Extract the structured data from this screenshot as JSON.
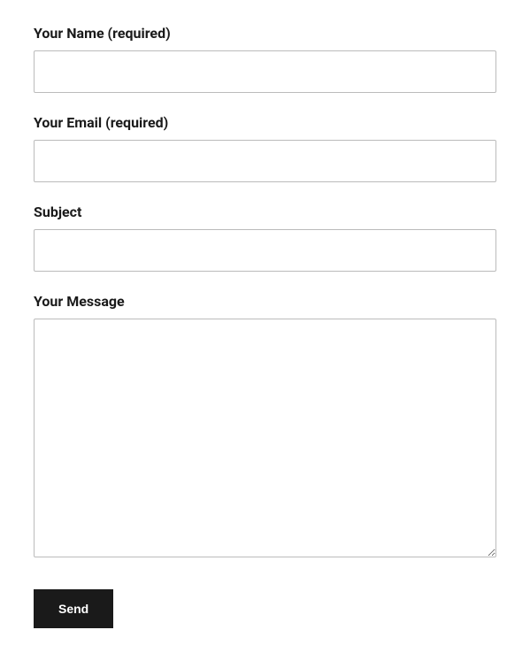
{
  "form": {
    "name": {
      "label": "Your Name (required)",
      "value": ""
    },
    "email": {
      "label": "Your Email (required)",
      "value": ""
    },
    "subject": {
      "label": "Subject",
      "value": ""
    },
    "message": {
      "label": "Your Message",
      "value": ""
    },
    "submit_label": "Send"
  }
}
